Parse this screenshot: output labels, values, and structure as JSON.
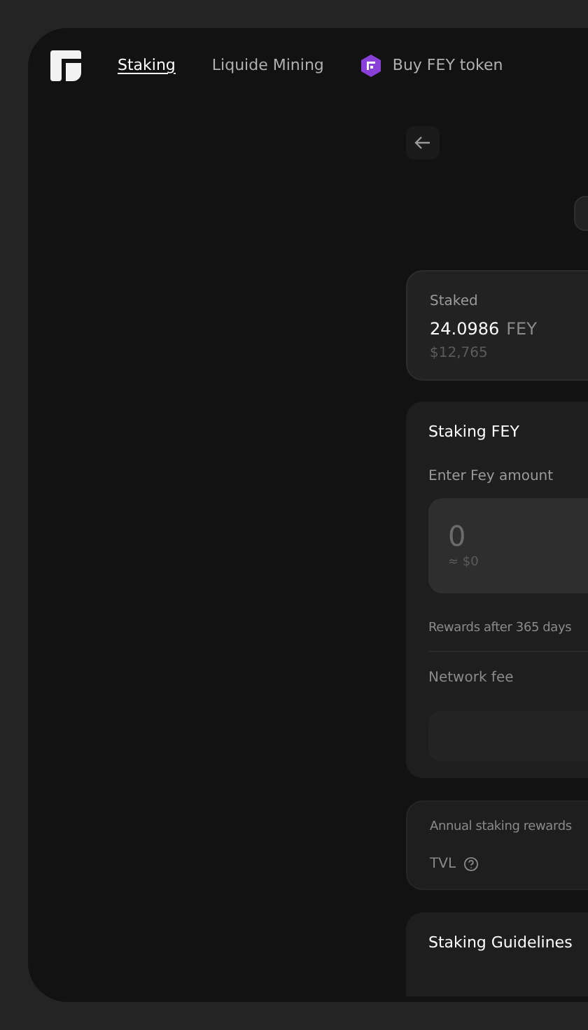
{
  "nav": {
    "items": [
      {
        "label": "Staking",
        "selected": true,
        "kind": "link"
      },
      {
        "label": "Liquide Mining",
        "selected": false,
        "kind": "link"
      },
      {
        "label": "Buy FEY token",
        "selected": false,
        "kind": "token"
      }
    ]
  },
  "staked": {
    "label": "Staked",
    "amount": "24.0986",
    "unit": "FEY",
    "usd": "$12,765"
  },
  "staking": {
    "title": "Staking FEY",
    "amount_label": "Enter Fey amount",
    "input": {
      "placeholder": "0",
      "usd": "≈ $0"
    },
    "rewards_label": "Rewards after 365 days",
    "fee_label": "Network fee"
  },
  "stats": {
    "annual_label": "Annual staking rewards",
    "tvl_label": "TVL"
  },
  "guidelines": {
    "title": "Staking Guidelines"
  }
}
